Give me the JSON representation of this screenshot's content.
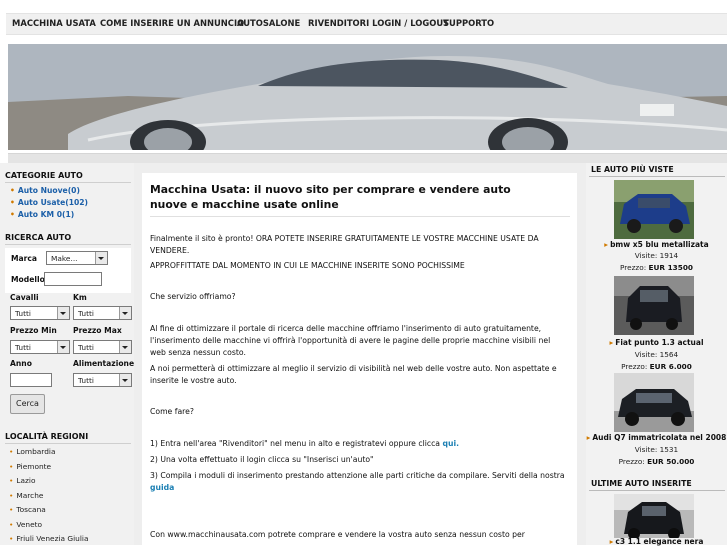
{
  "nav": {
    "items": [
      "MACCHINA USATA",
      "COME INSERIRE UN ANNUNCIO",
      "AUTOSALONE",
      "RIVENDITORI LOGIN / LOGOUT",
      "SUPPORTO"
    ]
  },
  "left": {
    "categories_title": "CATEGORIE AUTO",
    "categories": [
      "Auto Nuove(0)",
      "Auto Usate(102)",
      "Auto KM 0(1)"
    ],
    "search_title": "RICERCA AUTO",
    "marca_label": "Marca",
    "marca_value": "Make...",
    "modello_label": "Modello",
    "cavalli_label": "Cavalli",
    "km_label": "Km",
    "cavalli_value": "Tutti",
    "km_value": "Tutti",
    "prezzo_min_label": "Prezzo Min",
    "prezzo_max_label": "Prezzo Max",
    "prezzo_min_value": "Tutti",
    "prezzo_max_value": "Tutti",
    "anno_label": "Anno",
    "alimentazione_label": "Alimentazione",
    "alimentazione_value": "Tutti",
    "search_button": "Cerca",
    "regions_title": "LOCALITÀ REGIONI",
    "regions": [
      "Lombardia",
      "Piemonte",
      "Lazio",
      "Marche",
      "Toscana",
      "Veneto",
      "Friuli Venezia Giulia"
    ]
  },
  "article": {
    "title": "Macchina Usata: il nuovo sito per comprare e vendere auto nuove e macchine usate online",
    "p1": "Finalmente il sito è pronto! ORA POTETE INSERIRE GRATUITAMENTE LE VOSTRE MACCHINE USATE DA VENDERE.",
    "p2": "APPROFFITTATE DAL MOMENTO IN CUI LE MACCHINE INSERITE SONO POCHISSIME",
    "q1": "Che servizio offriamo?",
    "p3": "Al fine di ottimizzare il portale di ricerca delle macchine offriamo l'inserimento di auto gratuitamente, l'inserimento delle macchine vi offrirà l'opportunità di avere le pagine delle proprie macchine visibili nel web senza nessun costo.",
    "p4": "A noi permetterà di ottimizzare al meglio il servizio di visibilità nel web delle vostre auto. Non aspettate e inserite le vostre auto.",
    "q2": "Come fare?",
    "step1": "1) Entra nell'area \"Rivenditori\" nel menu in alto e registratevi oppure clicca ",
    "step1_link": "qui.",
    "step2": "2) Una volta effettuato il login clicca su \"Inserisci un'auto\"",
    "step3": "3) Compila i moduli di inserimento prestando attenzione alle parti critiche da compilare. Serviti della nostra ",
    "step3_link": "guida",
    "p5": "Con www.macchinausata.com potrete comprare e vendere la vostra auto senza nessun costo per"
  },
  "right": {
    "most_viewed_title": "LE AUTO PIÙ VISTE",
    "cars": [
      {
        "name": "bmw x5 blu metallizata",
        "views_label": "Visite:",
        "views": "1914",
        "price_label": "Prezzo:",
        "price": "EUR 13500"
      },
      {
        "name": "Fiat punto 1.3 actual",
        "views_label": "Visite:",
        "views": "1564",
        "price_label": "Prezzo:",
        "price": "EUR 6.000"
      },
      {
        "name": "Audi Q7 immatricolata nel 2008",
        "views_label": "Visite:",
        "views": "1531",
        "price_label": "Prezzo:",
        "price": "EUR 50.000"
      }
    ],
    "latest_title": "ULTIME AUTO INSERITE",
    "latest_car_name": "c3 1.1 elegance nera"
  },
  "colors": {
    "link": "#1b5fa8",
    "accent_bullet": "#d07a00",
    "panel": "#f1f1f1"
  }
}
